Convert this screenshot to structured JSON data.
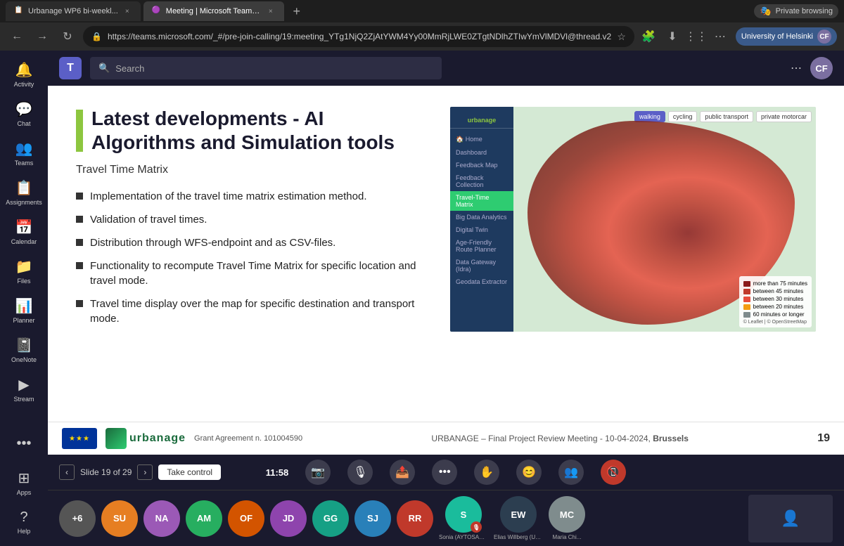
{
  "browser": {
    "tabs": [
      {
        "id": "tab1",
        "label": "Urbanage WP6 bi-weekl...",
        "favicon": "📋",
        "active": false
      },
      {
        "id": "tab2",
        "label": "Meeting | Microsoft Teams",
        "favicon": "🟣",
        "active": true,
        "playing": "PLAYING"
      }
    ],
    "new_tab_label": "+",
    "private_browsing_label": "Private browsing",
    "address": "https://teams.microsoft.com/_#/pre-join-calling/19:meeting_YTg1NjQ2ZjAtYWM4Yy00MmRjLWE0ZTgtNDlhZTIwYmVlMDVl@thread.v2",
    "org_label": "University of Helsinki"
  },
  "teams": {
    "sidebar": {
      "items": [
        {
          "id": "activity",
          "label": "Activity",
          "icon": "🔔"
        },
        {
          "id": "chat",
          "label": "Chat",
          "icon": "💬"
        },
        {
          "id": "teams",
          "label": "Teams",
          "icon": "👥"
        },
        {
          "id": "assignments",
          "label": "Assignments",
          "icon": "📋"
        },
        {
          "id": "calendar",
          "label": "Calendar",
          "icon": "📅"
        },
        {
          "id": "files",
          "label": "Files",
          "icon": "📁"
        },
        {
          "id": "planner",
          "label": "Planner",
          "icon": "📊"
        },
        {
          "id": "onenote",
          "label": "OneNote",
          "icon": "📓"
        },
        {
          "id": "stream",
          "label": "Stream",
          "icon": "▶️"
        },
        {
          "id": "more",
          "label": "...",
          "icon": "•••"
        },
        {
          "id": "apps",
          "label": "Apps",
          "icon": "⊞"
        },
        {
          "id": "help",
          "label": "Help",
          "icon": "?"
        }
      ]
    },
    "search_placeholder": "Search",
    "profile_initials": "CF"
  },
  "slide": {
    "title": "Latest developments - AI Algorithms and Simulation tools",
    "subtitle": "Travel Time Matrix",
    "bullets": [
      "Implementation of the travel time matrix estimation method.",
      "Validation of travel times.",
      "Distribution through WFS-endpoint and as CSV-files.",
      "Functionality to recompute Travel Time Matrix for specific location and travel mode.",
      "Travel time display over the map for specific destination and transport mode."
    ],
    "map": {
      "panel_items": [
        {
          "label": "Home",
          "active": false
        },
        {
          "label": "Dashboard",
          "active": false
        },
        {
          "label": "Feedback Map",
          "active": false
        },
        {
          "label": "Feedback Collection",
          "active": false
        },
        {
          "label": "Travel-Time Matrix",
          "active": true
        },
        {
          "label": "Big Data Analytics",
          "active": false
        },
        {
          "label": "Digital Twin",
          "active": false
        },
        {
          "label": "Age-Friendly Route Planner",
          "active": false
        },
        {
          "label": "Data Gateway (Idra)",
          "active": false
        },
        {
          "label": "Geodata Extractor",
          "active": false
        }
      ],
      "transport_modes": [
        "walking",
        "cycling",
        "public transport",
        "private motorcar"
      ],
      "active_mode": "walking",
      "legend": [
        {
          "color": "#c0392b",
          "label": "more than 75 minutes"
        },
        {
          "color": "#e74c3c",
          "label": "between 45 minutes"
        },
        {
          "color": "#e67e22",
          "label": "between 30 minutes"
        },
        {
          "color": "#f39c12",
          "label": "between 20 minutes"
        },
        {
          "color": "#2ecc71",
          "label": "60 minutes or longer"
        }
      ]
    },
    "bottom": {
      "grant_label": "Grant Agreement  n. 101004590",
      "meeting_title": "URBANAGE – Final Project Review Meeting - 10-04-2024,",
      "city": "Brussels",
      "slide_number": "19"
    }
  },
  "meeting": {
    "slide_nav": {
      "current": "19",
      "total": "29",
      "label": "Slide 19 of 29",
      "take_control": "Take control"
    },
    "time": "11:58",
    "controls": [
      {
        "id": "video",
        "icon": "📷",
        "label": "Camera"
      },
      {
        "id": "mic",
        "icon": "🎙️",
        "label": "Microphone"
      },
      {
        "id": "share",
        "icon": "📤",
        "label": "Share"
      },
      {
        "id": "more",
        "icon": "•••",
        "label": "More"
      },
      {
        "id": "hand",
        "icon": "✋",
        "label": "Raise hand"
      },
      {
        "id": "react",
        "icon": "😊",
        "label": "React"
      },
      {
        "id": "participants",
        "icon": "👥",
        "label": "Participants"
      },
      {
        "id": "hangup",
        "icon": "📵",
        "label": "Hang up",
        "color": "red"
      }
    ],
    "participants": [
      {
        "initials": "+6",
        "color": "#666",
        "label": ""
      },
      {
        "initials": "SU",
        "color": "#e67e22",
        "label": ""
      },
      {
        "initials": "NA",
        "color": "#9b59b6",
        "label": ""
      },
      {
        "initials": "AM",
        "color": "#27ae60",
        "label": ""
      },
      {
        "initials": "OF",
        "color": "#d35400",
        "label": ""
      },
      {
        "initials": "JD",
        "color": "#8e44ad",
        "label": ""
      },
      {
        "initials": "GG",
        "color": "#16a085",
        "label": ""
      },
      {
        "initials": "SJ",
        "color": "#2980b9",
        "label": ""
      },
      {
        "initials": "RR",
        "color": "#c0392b",
        "label": ""
      },
      {
        "initials": "S",
        "color": "#1abc9c",
        "label": "Sonia (AYTOSAN) (G...",
        "has_mic": true
      },
      {
        "initials": "EW",
        "color": "#2c3e50",
        "label": "Elias Willberg (UH) (...",
        "has_mic": false
      },
      {
        "initials": "MC",
        "color": "#7f8c8d",
        "label": "Maria Chi...",
        "has_mic": false
      }
    ]
  }
}
